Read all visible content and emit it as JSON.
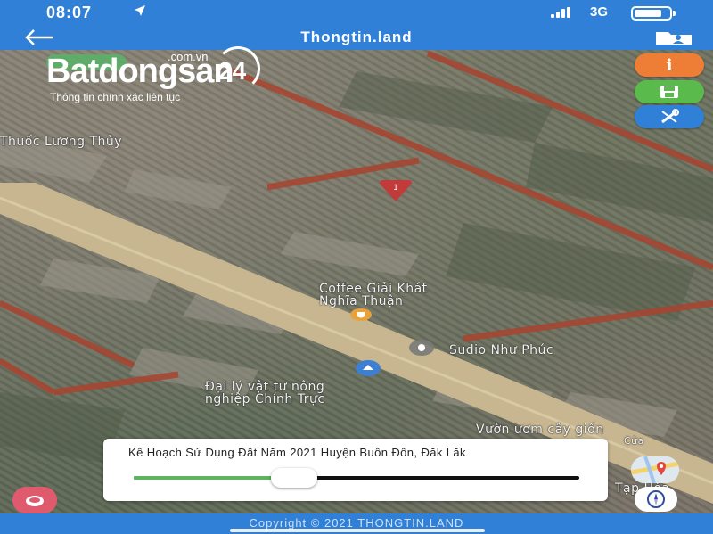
{
  "status_bar": {
    "time": "08:07",
    "location_icon": "location-arrow-icon",
    "network": "3G",
    "battery_percent": 80
  },
  "header": {
    "title": "Thongtin.land",
    "back_icon": "back-arrow-icon",
    "folder_icon": "folder-user-icon"
  },
  "brand": {
    "name": "Batdongsan",
    "suffix": "24",
    "domain": ".com.vn",
    "tagline": "Thông tin chính xác liên tục"
  },
  "side_buttons": [
    {
      "name": "info-button",
      "icon": "info-icon",
      "label": "i",
      "color": "#ee7e35"
    },
    {
      "name": "save-button",
      "icon": "save-icon",
      "color": "#5aba4b"
    },
    {
      "name": "tools-button",
      "icon": "tools-icon",
      "color": "#2f80d6"
    }
  ],
  "map": {
    "parcel_marker": "1",
    "labels": {
      "pharmacy": "Thuốc Lương Thủy",
      "coffee_line1": "Coffee Giải Khát",
      "coffee_line2": "Nghĩa Thuận",
      "studio": "Sudio Như Phúc",
      "agency_line1": "Đại lý vật tư nông",
      "agency_line2": "nghiệp Chính Trực",
      "nursery_line1": "Vườn ươm cây giốn",
      "nursery_line2": "Cửa",
      "partial_label": "Tạp Hóa"
    }
  },
  "panel": {
    "title": "Kế Hoạch Sử Dụng Đất Năm 2021 Huyện Buôn Đôn, Đăk Lăk",
    "slider_value_percent": 36
  },
  "footer": {
    "copyright": "Copyright © 2021 THONGTIN.LAND"
  },
  "colors": {
    "primary": "#2f80d6",
    "accent_orange": "#ee7e35",
    "accent_green": "#5aba4b",
    "layers_pink": "#e05a6e",
    "parcel_red": "#c23b3b"
  }
}
